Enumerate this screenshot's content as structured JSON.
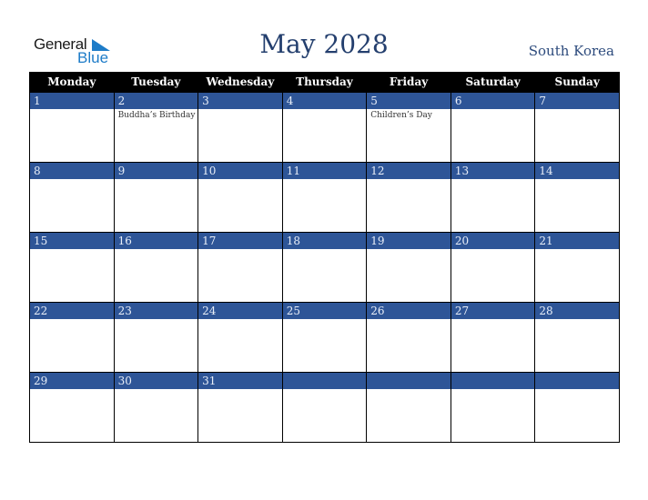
{
  "logo": {
    "general": "General",
    "blue": "Blue"
  },
  "header": {
    "title": "May 2028",
    "country": "South Korea"
  },
  "colors": {
    "accent": "#2e5597",
    "title": "#243f6e",
    "header_bg": "#000000"
  },
  "weekdays": [
    "Monday",
    "Tuesday",
    "Wednesday",
    "Thursday",
    "Friday",
    "Saturday",
    "Sunday"
  ],
  "weeks": [
    [
      {
        "day": "1",
        "event": ""
      },
      {
        "day": "2",
        "event": "Buddha’s Birthday"
      },
      {
        "day": "3",
        "event": ""
      },
      {
        "day": "4",
        "event": ""
      },
      {
        "day": "5",
        "event": "Children’s Day"
      },
      {
        "day": "6",
        "event": ""
      },
      {
        "day": "7",
        "event": ""
      }
    ],
    [
      {
        "day": "8",
        "event": ""
      },
      {
        "day": "9",
        "event": ""
      },
      {
        "day": "10",
        "event": ""
      },
      {
        "day": "11",
        "event": ""
      },
      {
        "day": "12",
        "event": ""
      },
      {
        "day": "13",
        "event": ""
      },
      {
        "day": "14",
        "event": ""
      }
    ],
    [
      {
        "day": "15",
        "event": ""
      },
      {
        "day": "16",
        "event": ""
      },
      {
        "day": "17",
        "event": ""
      },
      {
        "day": "18",
        "event": ""
      },
      {
        "day": "19",
        "event": ""
      },
      {
        "day": "20",
        "event": ""
      },
      {
        "day": "21",
        "event": ""
      }
    ],
    [
      {
        "day": "22",
        "event": ""
      },
      {
        "day": "23",
        "event": ""
      },
      {
        "day": "24",
        "event": ""
      },
      {
        "day": "25",
        "event": ""
      },
      {
        "day": "26",
        "event": ""
      },
      {
        "day": "27",
        "event": ""
      },
      {
        "day": "28",
        "event": ""
      }
    ],
    [
      {
        "day": "29",
        "event": ""
      },
      {
        "day": "30",
        "event": ""
      },
      {
        "day": "31",
        "event": ""
      },
      {
        "day": "",
        "event": ""
      },
      {
        "day": "",
        "event": ""
      },
      {
        "day": "",
        "event": ""
      },
      {
        "day": "",
        "event": ""
      }
    ]
  ]
}
